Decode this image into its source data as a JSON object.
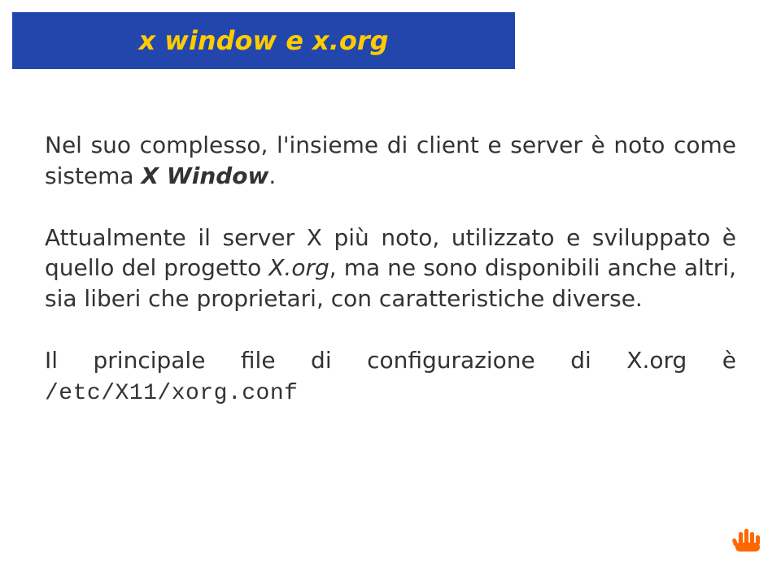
{
  "header": {
    "title": "x window e x.org"
  },
  "body": {
    "p1": {
      "t1": "Nel suo complesso, l'insieme di client e server è noto come sistema ",
      "t2": "X Window",
      "t3": "."
    },
    "p2": {
      "t1": "Attualmente il server X più noto, utilizzato e sviluppato è quello del progetto ",
      "t2": "X.org",
      "t3": ", ma ne sono disponibili anche altri, sia liberi che proprietari, con caratteristiche diverse."
    },
    "p3": {
      "t1": "Il principale file di configurazione di X.org è ",
      "t2": "/etc/X11/xorg.conf"
    }
  }
}
